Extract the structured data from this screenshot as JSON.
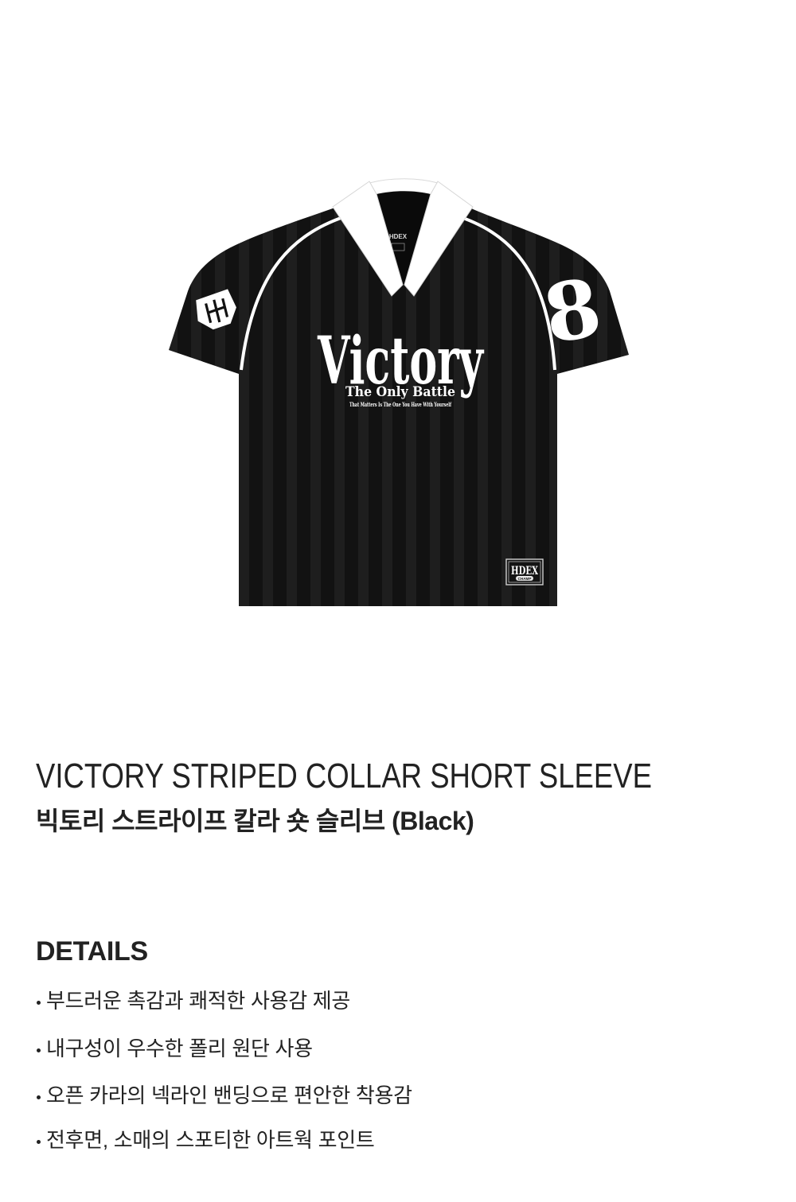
{
  "product_image": {
    "graphics": {
      "print_main": "Victory",
      "print_sub": "The Only Battle",
      "print_tagline": "That Matters Is The One You Have With Yourself",
      "sleeve_number": "8",
      "neck_label": "HDEX",
      "patch_brand": "HDEX",
      "patch_sub": "CHAMP"
    }
  },
  "product": {
    "name_en": "VICTORY STRIPED COLLAR SHORT SLEEVE",
    "name_ko": "빅토리 스트라이프 칼라 숏 슬리브 (Black)"
  },
  "details": {
    "heading": "DETAILS",
    "items": [
      "부드러운 촉감과 쾌적한 사용감 제공",
      "내구성이 우수한 폴리 원단 사용",
      "오픈 카라의 넥라인 밴딩으로 편안한 착용감",
      "전후면, 소매의 스포티한 아트웍 포인트"
    ]
  },
  "colors": {
    "background": "#ffffff",
    "text": "#222222",
    "shirt_body": "#121212",
    "shirt_trim": "#ffffff"
  }
}
